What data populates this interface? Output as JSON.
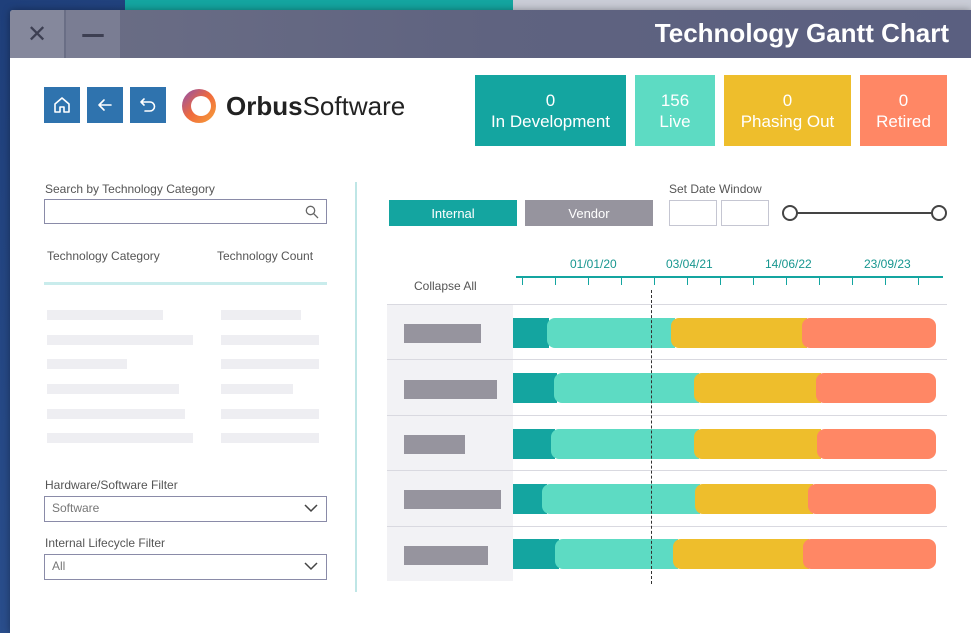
{
  "window": {
    "title": "Technology Gantt Chart"
  },
  "titlebar": {
    "close_glyph": "✕",
    "minimize_glyph": "—"
  },
  "logo": {
    "bold": "Orbus",
    "light": "Software"
  },
  "kpis": [
    {
      "value": "0",
      "label": "In Development",
      "color": "#14a5a0"
    },
    {
      "value": "156",
      "label": "Live",
      "color": "#5ddbc3"
    },
    {
      "value": "0",
      "label": "Phasing Out",
      "color": "#eebe2c"
    },
    {
      "value": "0",
      "label": "Retired",
      "color": "#ff8765"
    }
  ],
  "search": {
    "label": "Search by Technology Category",
    "value": "",
    "placeholder": ""
  },
  "table": {
    "col1": "Technology Category",
    "col2": "Technology Count"
  },
  "filters": {
    "hw_sw": {
      "label": "Hardware/Software Filter",
      "value": "Software"
    },
    "lifecycle": {
      "label": "Internal Lifecycle Filter",
      "value": "All"
    }
  },
  "toggles": {
    "internal": "Internal",
    "vendor": "Vendor"
  },
  "date_window": {
    "label": "Set Date Window",
    "start": "",
    "end": ""
  },
  "gantt": {
    "collapse_label": "Collapse All",
    "axis_labels": [
      "01/01/20",
      "03/04/21",
      "14/06/22",
      "23/09/23"
    ],
    "phase_colors": {
      "in_development": "#14a5a0",
      "live": "#5ddbc3",
      "phasing_out": "#eebe2c",
      "retired": "#ff8765"
    }
  },
  "icons": [
    "home-icon",
    "back-arrow-icon",
    "undo-icon",
    "search-icon",
    "chevron-down-icon"
  ]
}
